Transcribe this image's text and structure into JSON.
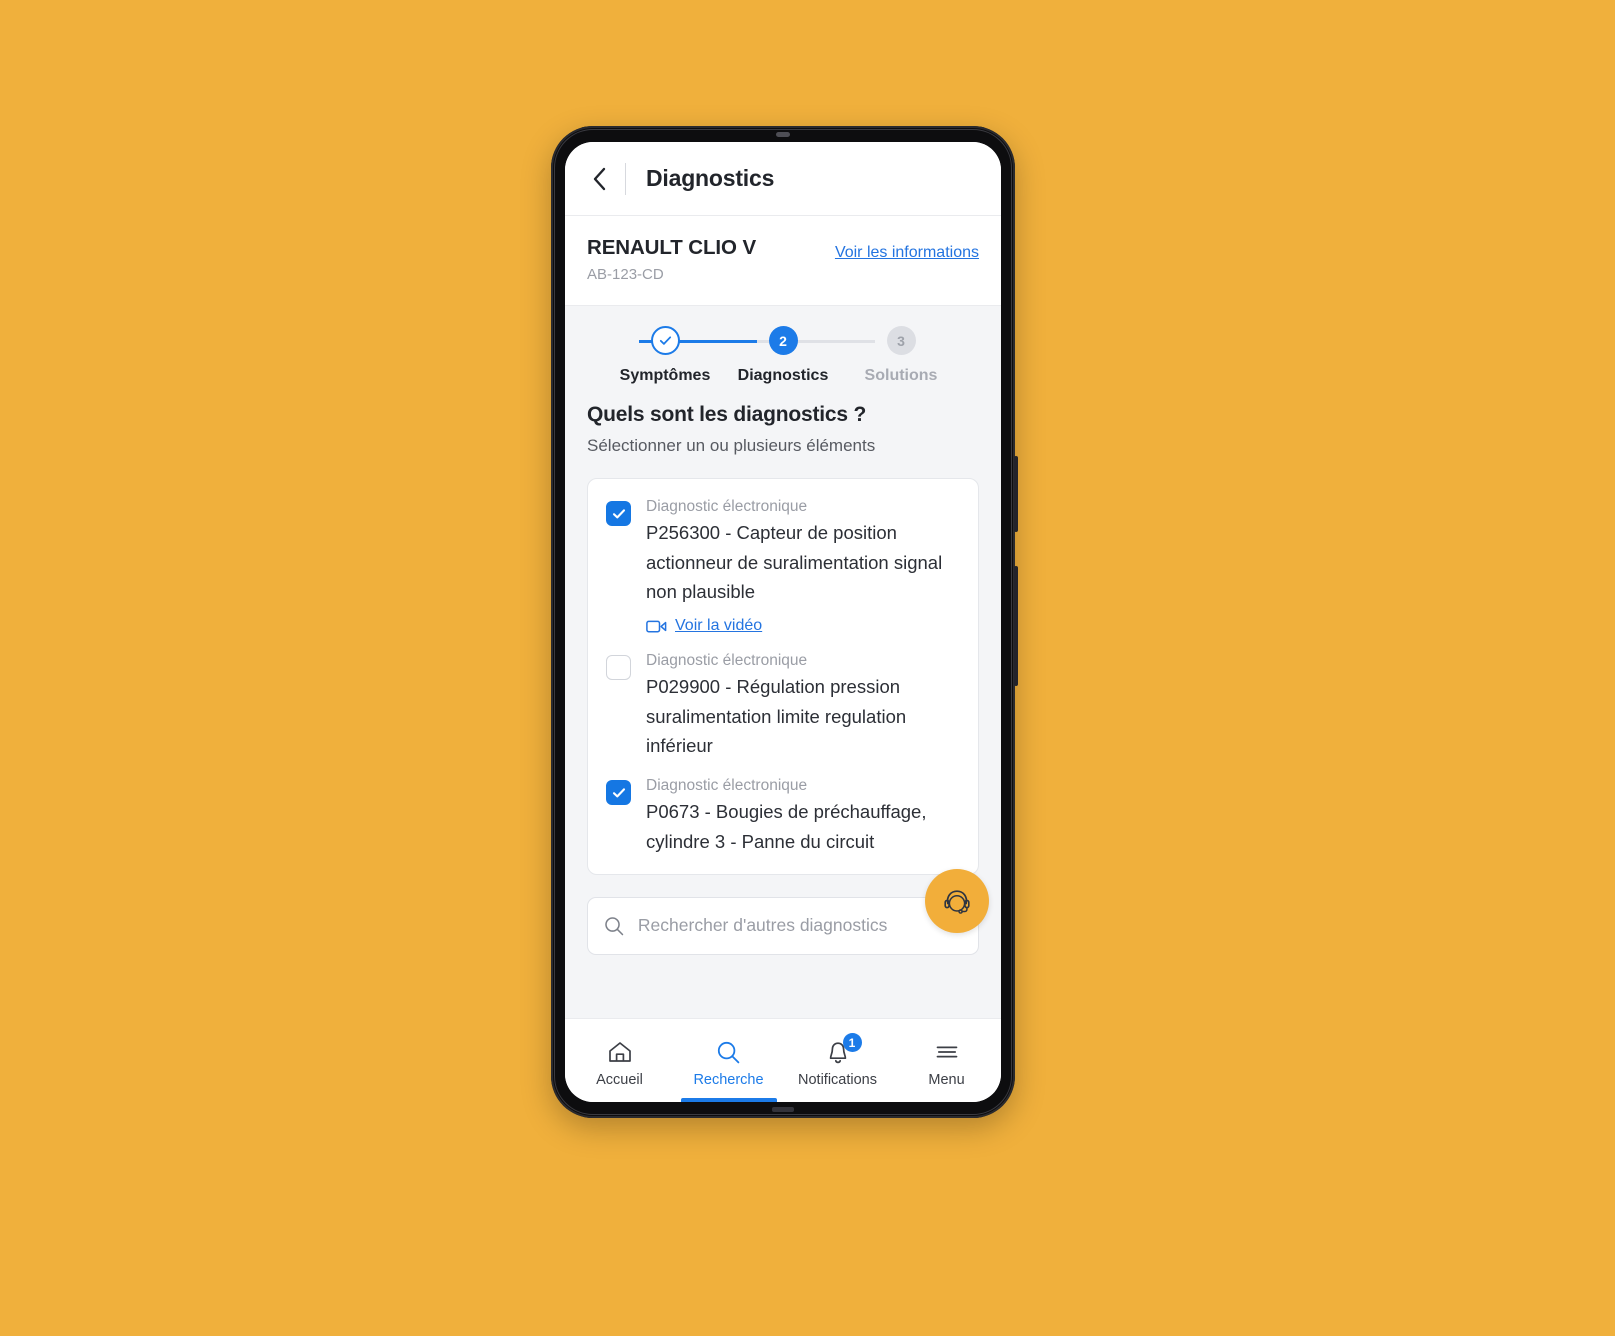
{
  "app_bar": {
    "back_icon": "chevron-left-icon",
    "title": "Diagnostics"
  },
  "vehicle": {
    "name": "RENAULT CLIO V",
    "plate": "AB-123-CD",
    "info_link": "Voir les informations"
  },
  "stepper": {
    "steps": [
      {
        "label": "Symptômes",
        "badge": "✓",
        "state": "done"
      },
      {
        "label": "Diagnostics",
        "badge": "2",
        "state": "active"
      },
      {
        "label": "Solutions",
        "badge": "3",
        "state": "todo"
      }
    ]
  },
  "question": {
    "title": "Quels sont les diagnostics ?",
    "subtitle": "Sélectionner un ou plusieurs éléments"
  },
  "diagnostics": {
    "items": [
      {
        "kind": "Diagnostic électronique",
        "code": "P256300 - Capteur de position actionneur de suralimentation signal non plausible",
        "checked": true,
        "video_label": "Voir la vidéo",
        "has_video": true
      },
      {
        "kind": "Diagnostic électronique",
        "code": "P029900 - Régulation pression suralimentation limite regulation inférieur",
        "checked": false,
        "has_video": false
      },
      {
        "kind": "Diagnostic électronique",
        "code": "P0673 - Bougies de préchauffage, cylindre 3 - Panne du circuit",
        "checked": true,
        "has_video": false
      }
    ]
  },
  "search": {
    "placeholder": "Rechercher d'autres diagnostics",
    "value": "",
    "icon": "search-icon"
  },
  "support_fab": {
    "icon": "headset-icon",
    "color": "#F2AE3A"
  },
  "bottom_nav": {
    "items": [
      {
        "label": "Accueil",
        "icon": "home-icon",
        "active": false,
        "badge": ""
      },
      {
        "label": "Recherche",
        "icon": "search-icon",
        "active": true,
        "badge": ""
      },
      {
        "label": "Notifications",
        "icon": "bell-icon",
        "active": false,
        "badge": "1"
      },
      {
        "label": "Menu",
        "icon": "hamburger-icon",
        "active": false,
        "badge": ""
      }
    ]
  },
  "colors": {
    "background": "#F0B03C",
    "accent_blue": "#1C7BE8",
    "link_blue": "#2474E0",
    "fab_orange": "#F2AE3A",
    "screen_bg": "#F4F5F7"
  }
}
